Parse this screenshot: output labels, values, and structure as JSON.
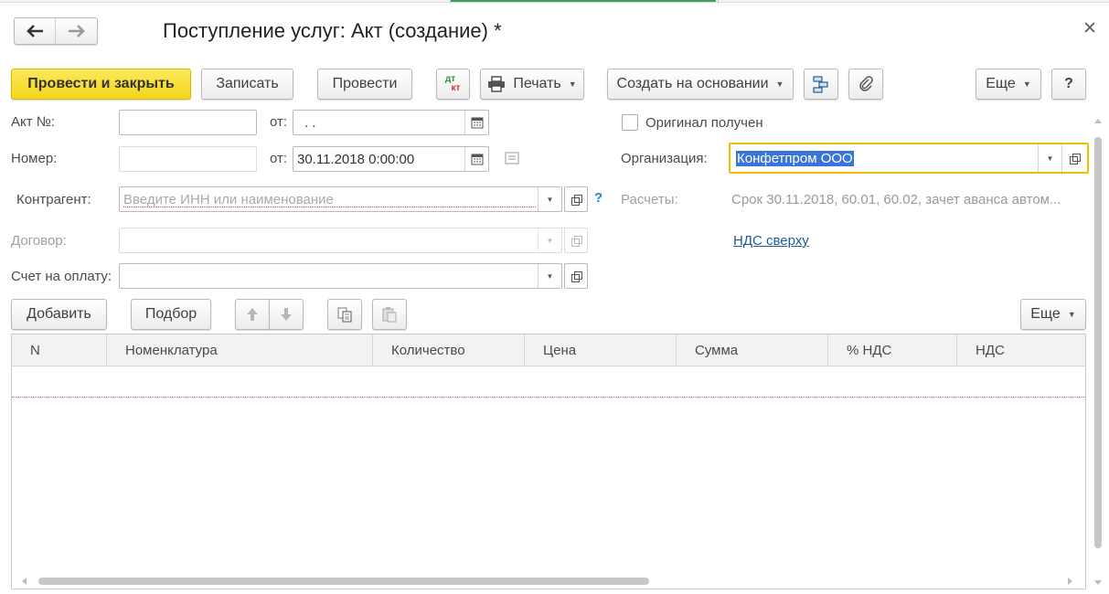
{
  "window": {
    "title": "Поступление услуг: Акт (создание) *"
  },
  "toolbar": {
    "post_close": "Провести и закрыть",
    "save": "Записать",
    "post": "Провести",
    "dtkt_top": "дт",
    "dtkt_bottom": "кт",
    "print": "Печать",
    "create_based": "Создать на основании",
    "more": "Еще",
    "help": "?"
  },
  "form": {
    "act_no_label": "Акт №:",
    "act_no_value": "",
    "from_label": "от:",
    "act_date_value": " .  .",
    "number_label": "Номер:",
    "number_value": "",
    "number_date_value": "30.11.2018  0:00:00",
    "counterparty_label": "Контрагент:",
    "counterparty_placeholder": "Введите ИНН или наименование",
    "help_mark": "?",
    "contract_label": "Договор:",
    "invoice_label": "Счет на оплату:",
    "original_received_label": "Оригинал получен",
    "original_received_checked": false,
    "org_label": "Организация:",
    "org_value": "Конфетпром ООО",
    "settlements_label": "Расчеты:",
    "settlements_value": "Срок 30.11.2018, 60.01, 60.02, зачет аванса автом...",
    "vat_link": "НДС сверху"
  },
  "table_toolbar": {
    "add": "Добавить",
    "pick": "Подбор",
    "more": "Еще"
  },
  "table": {
    "columns": [
      "N",
      "Номенклатура",
      "Количество",
      "Цена",
      "Сумма",
      "% НДС",
      "НДС"
    ],
    "rows": []
  },
  "colors": {
    "primary_button": "#f5d51d",
    "focus_border": "#f0c000",
    "selection": "#3875d7",
    "link": "#1f5a96",
    "help": "#2a7fc4"
  }
}
